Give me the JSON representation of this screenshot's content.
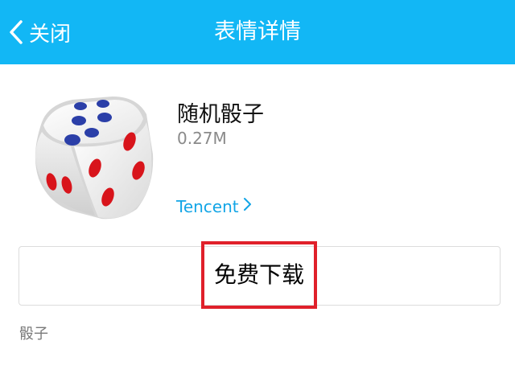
{
  "header": {
    "back_label": "关闭",
    "title": "表情详情"
  },
  "sticker": {
    "name": "随机骰子",
    "size": "0.27M",
    "author": "Tencent",
    "description": "骰子"
  },
  "actions": {
    "download_label": "免费下载"
  },
  "colors": {
    "header_bg": "#12b7f5",
    "link": "#12a5e6",
    "highlight": "#e0202a"
  },
  "icons": {
    "back": "chevron-left-icon",
    "author": "chevron-right-icon",
    "sticker": "dice-icon"
  }
}
